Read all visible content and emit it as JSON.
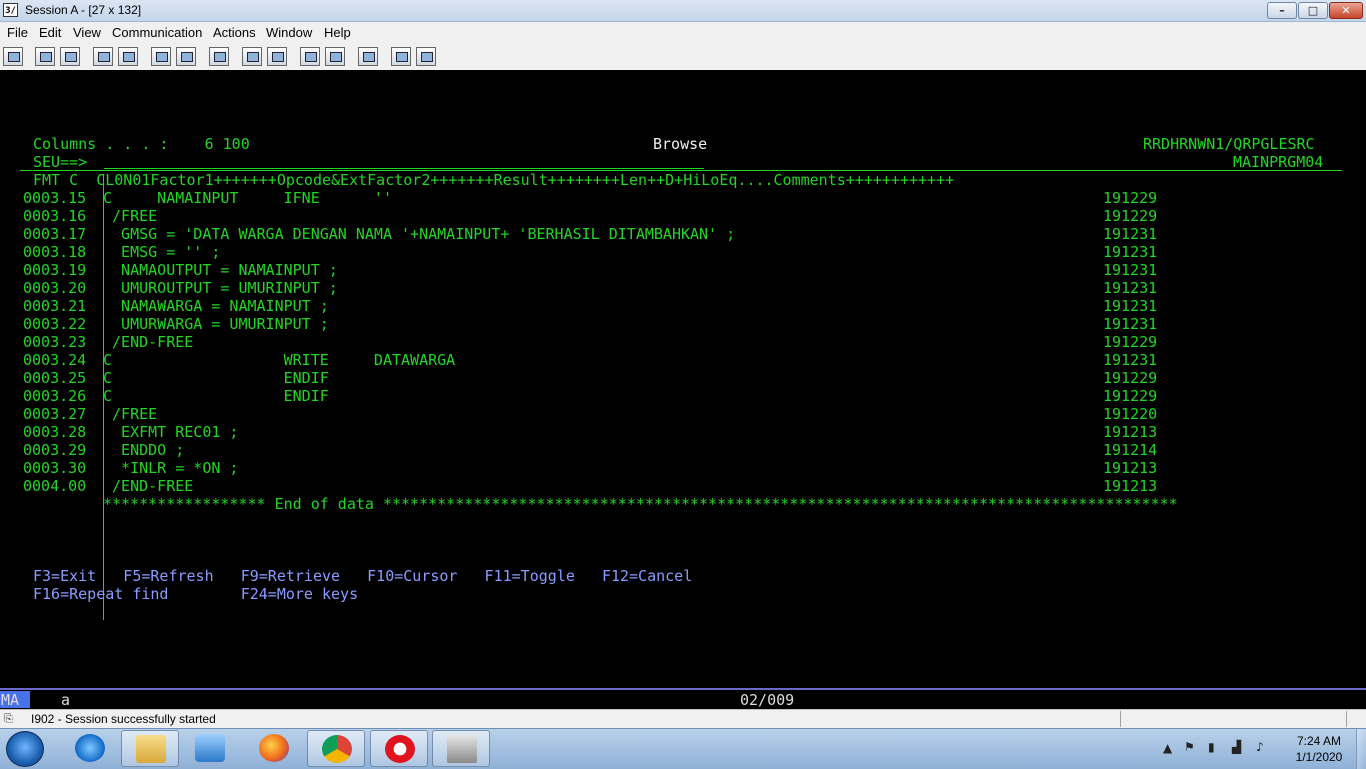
{
  "window": {
    "title": "Session A - [27 x 132]",
    "app_icon_label": "3/",
    "controls": {
      "minimize": "–",
      "maximize": "□",
      "close": "✕"
    }
  },
  "menu": [
    "File",
    "Edit",
    "View",
    "Communication",
    "Actions",
    "Window",
    "Help"
  ],
  "toolbar_icons": [
    "print-screen-icon",
    "copy-icon",
    "paste-icon",
    "send-file-icon",
    "receive-file-icon",
    "display-icon",
    "keypad-icon",
    "macro-icon",
    "record-macro-icon",
    "play-macro-icon",
    "stop-macro-icon",
    "play-macro-2-icon",
    "clipboard-icon",
    "globe-icon",
    "help-icon"
  ],
  "screen": {
    "columns_label": "Columns . . . :    6 100",
    "mode": "Browse",
    "source_file": "RRDHRNWN1/QRPGLESRC",
    "seu_prompt": "SEU==>",
    "member": "MAINPRGM04",
    "format_header": "FMT C  CL0N01Factor1+++++++Opcode&ExtFactor2+++++++Result++++++++Len++D+HiLoEq....Comments++++++++++++",
    "lines": [
      {
        "seq": "0003.15",
        "text": "C     NAMAINPUT     IFNE      ''",
        "date": "191229"
      },
      {
        "seq": "0003.16",
        "text": " /FREE",
        "date": "191229"
      },
      {
        "seq": "0003.17",
        "text": "  GMSG = 'DATA WARGA DENGAN NAMA '+NAMAINPUT+ 'BERHASIL DITAMBAHKAN' ;",
        "date": "191231"
      },
      {
        "seq": "0003.18",
        "text": "  EMSG = '' ;",
        "date": "191231"
      },
      {
        "seq": "0003.19",
        "text": "  NAMAOUTPUT = NAMAINPUT ;",
        "date": "191231"
      },
      {
        "seq": "0003.20",
        "text": "  UMUROUTPUT = UMURINPUT ;",
        "date": "191231"
      },
      {
        "seq": "0003.21",
        "text": "  NAMAWARGA = NAMAINPUT ;",
        "date": "191231"
      },
      {
        "seq": "0003.22",
        "text": "  UMURWARGA = UMURINPUT ;",
        "date": "191231"
      },
      {
        "seq": "0003.23",
        "text": " /END-FREE",
        "date": "191229"
      },
      {
        "seq": "0003.24",
        "text": "C                   WRITE     DATAWARGA",
        "date": "191231"
      },
      {
        "seq": "0003.25",
        "text": "C                   ENDIF",
        "date": "191229"
      },
      {
        "seq": "0003.26",
        "text": "C                   ENDIF",
        "date": "191229"
      },
      {
        "seq": "0003.27",
        "text": " /FREE",
        "date": "191220"
      },
      {
        "seq": "0003.28",
        "text": "  EXFMT REC01 ;",
        "date": "191213"
      },
      {
        "seq": "0003.29",
        "text": "  ENDDO ;",
        "date": "191214"
      },
      {
        "seq": "0003.30",
        "text": "  *INLR = *ON ;",
        "date": "191213"
      },
      {
        "seq": "0004.00",
        "text": " /END-FREE",
        "date": "191213"
      }
    ],
    "end_of_data": "****************** End of data ****************************************************************************************",
    "function_keys_row1": "F3=Exit   F5=Refresh   F9=Retrieve   F10=Cursor   F11=Toggle   F12=Cancel",
    "function_keys_row2": "F16=Repeat find        F24=More keys"
  },
  "oia": {
    "indicator": "MA",
    "mode": "a",
    "cursor_position": "02/009"
  },
  "status": {
    "text": "I902 - Session successfully started"
  },
  "taskbar": {
    "apps": [
      "internet-explorer-icon",
      "file-explorer-icon",
      "media-player-icon",
      "firefox-icon",
      "chrome-icon",
      "opera-icon",
      "ibm-i-access-icon"
    ],
    "clock_time": "7:24 AM",
    "clock_date": "1/1/2020"
  }
}
